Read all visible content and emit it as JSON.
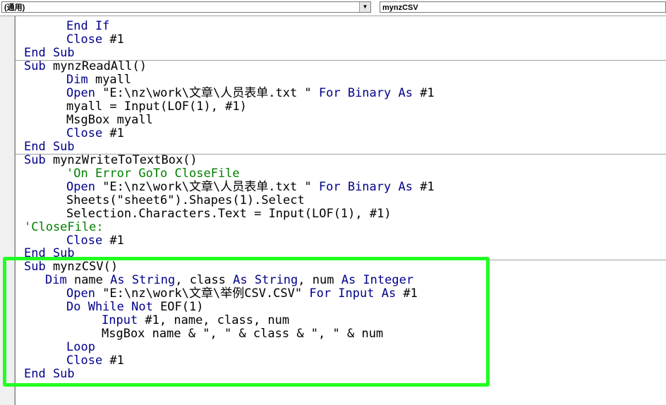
{
  "toolbar": {
    "object_combo": "(通用)",
    "procedure_combo": "mynzCSV"
  },
  "colors": {
    "keyword": "#00008b",
    "comment": "#008000",
    "highlight": "#22ff22"
  },
  "code": {
    "l1": {
      "kw": "End If"
    },
    "l2": {
      "kw": "Close",
      "rest": " #1"
    },
    "l3": {
      "kw": "End Sub"
    },
    "l4": {
      "kw": "Sub",
      "rest": " mynzReadAll()"
    },
    "l5": {
      "kw": "Dim",
      "rest": " myall"
    },
    "l6": {
      "kw": "Open",
      "rest": " \"E:\\nz\\work\\文章\\人员表单.txt \" ",
      "kw2": "For Binary As",
      "rest2": " #1"
    },
    "l7": {
      "rest": "myall = Input(LOF(1), #1)"
    },
    "l8": {
      "rest": "MsgBox myall"
    },
    "l9": {
      "kw": "Close",
      "rest": " #1"
    },
    "l10": {
      "kw": "End Sub"
    },
    "l11": {
      "kw": "Sub",
      "rest": " mynzWriteToTextBox()"
    },
    "l12": {
      "cm": "'On Error GoTo CloseFile"
    },
    "l13": {
      "kw": "Open",
      "rest": " \"E:\\nz\\work\\文章\\人员表单.txt \" ",
      "kw2": "For Binary As",
      "rest2": " #1"
    },
    "l14": {
      "rest": "Sheets(\"sheet6\").Shapes(1).Select"
    },
    "l15": {
      "rest": "Selection.Characters.Text = Input(LOF(1), #1)"
    },
    "l16": {
      "cm": "'CloseFile:"
    },
    "l17": {
      "kw": "Close",
      "rest": " #1"
    },
    "l18": {
      "kw": "End Sub"
    },
    "l19": {
      "kw": "Sub",
      "rest": " mynzCSV()"
    },
    "l20": {
      "kw": "Dim",
      "rest": " name ",
      "kw2": "As String",
      "rest2": ", class ",
      "kw3": "As String",
      "rest3": ", num ",
      "kw4": "As Integer"
    },
    "l21": {
      "kw": "Open",
      "rest": " \"E:\\nz\\work\\文章\\举例CSV.CSV\" ",
      "kw2": "For Input As",
      "rest2": " #1"
    },
    "l22": {
      "kw": "Do While Not",
      "rest": " EOF(1)"
    },
    "l23": {
      "kw": "Input",
      "rest": " #1, name, class, num"
    },
    "l24": {
      "rest": "MsgBox name & \", \" & class & \", \" & num"
    },
    "l25": {
      "kw": "Loop"
    },
    "l26": {
      "kw": "Close",
      "rest": " #1"
    },
    "l27": {
      "kw": "End Sub"
    }
  }
}
